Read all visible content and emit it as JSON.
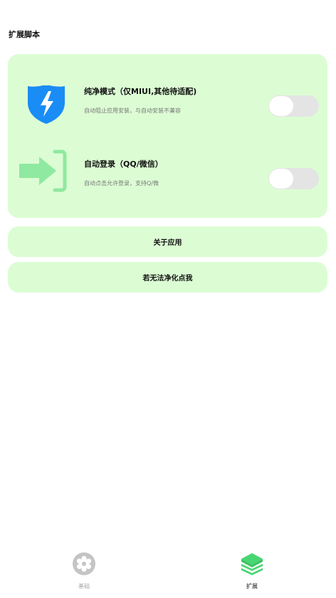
{
  "page": {
    "section_title": "扩展脚本"
  },
  "scripts": [
    {
      "icon": "shield-lightning-icon",
      "title": "纯净模式（仅MIUI,其他待适配)",
      "description": "自动阻止应用安装，与自动安装不兼容",
      "enabled": false
    },
    {
      "icon": "login-arrow-icon",
      "title": "自动登录（QQ/微信）",
      "description": "自动点击允许登录，支持Q/微",
      "enabled": false
    }
  ],
  "actions": {
    "about_label": "关于应用",
    "fix_label": "若无法净化点我"
  },
  "bottom_nav": {
    "items": [
      {
        "label": "基础",
        "icon": "gear-icon",
        "active": false
      },
      {
        "label": "扩展",
        "icon": "layers-icon",
        "active": true
      }
    ]
  },
  "colors": {
    "card_background": "#dcfdd4",
    "accent_green": "#47d672",
    "shield_blue": "#1a8cf5",
    "toggle_track_off": "#e4e4e4",
    "nav_inactive": "#a8a8a8"
  }
}
